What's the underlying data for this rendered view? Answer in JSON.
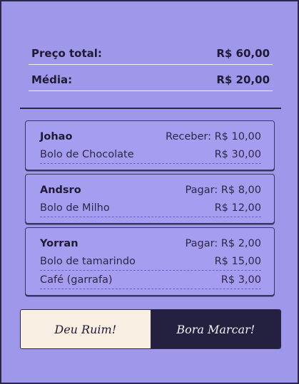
{
  "summary": {
    "total_label": "Preço total:",
    "total_value": "R$ 60,00",
    "average_label": "Média:",
    "average_value": "R$ 20,00"
  },
  "people": [
    {
      "name": "Johao",
      "status": "Receber: R$ 10,00",
      "items": [
        {
          "name": "Bolo de Chocolate",
          "price": "R$ 30,00"
        }
      ]
    },
    {
      "name": "Andsro",
      "status": "Pagar: R$ 8,00",
      "items": [
        {
          "name": "Bolo de Milho",
          "price": "R$ 12,00"
        }
      ]
    },
    {
      "name": "Yorran",
      "status": "Pagar: R$ 2,00",
      "items": [
        {
          "name": "Bolo de tamarindo",
          "price": "R$ 15,00"
        },
        {
          "name": "Café (garrafa)",
          "price": "R$ 3,00"
        }
      ]
    }
  ],
  "actions": {
    "cancel_label": "Deu Ruim!",
    "confirm_label": "Bora Marcar!"
  }
}
